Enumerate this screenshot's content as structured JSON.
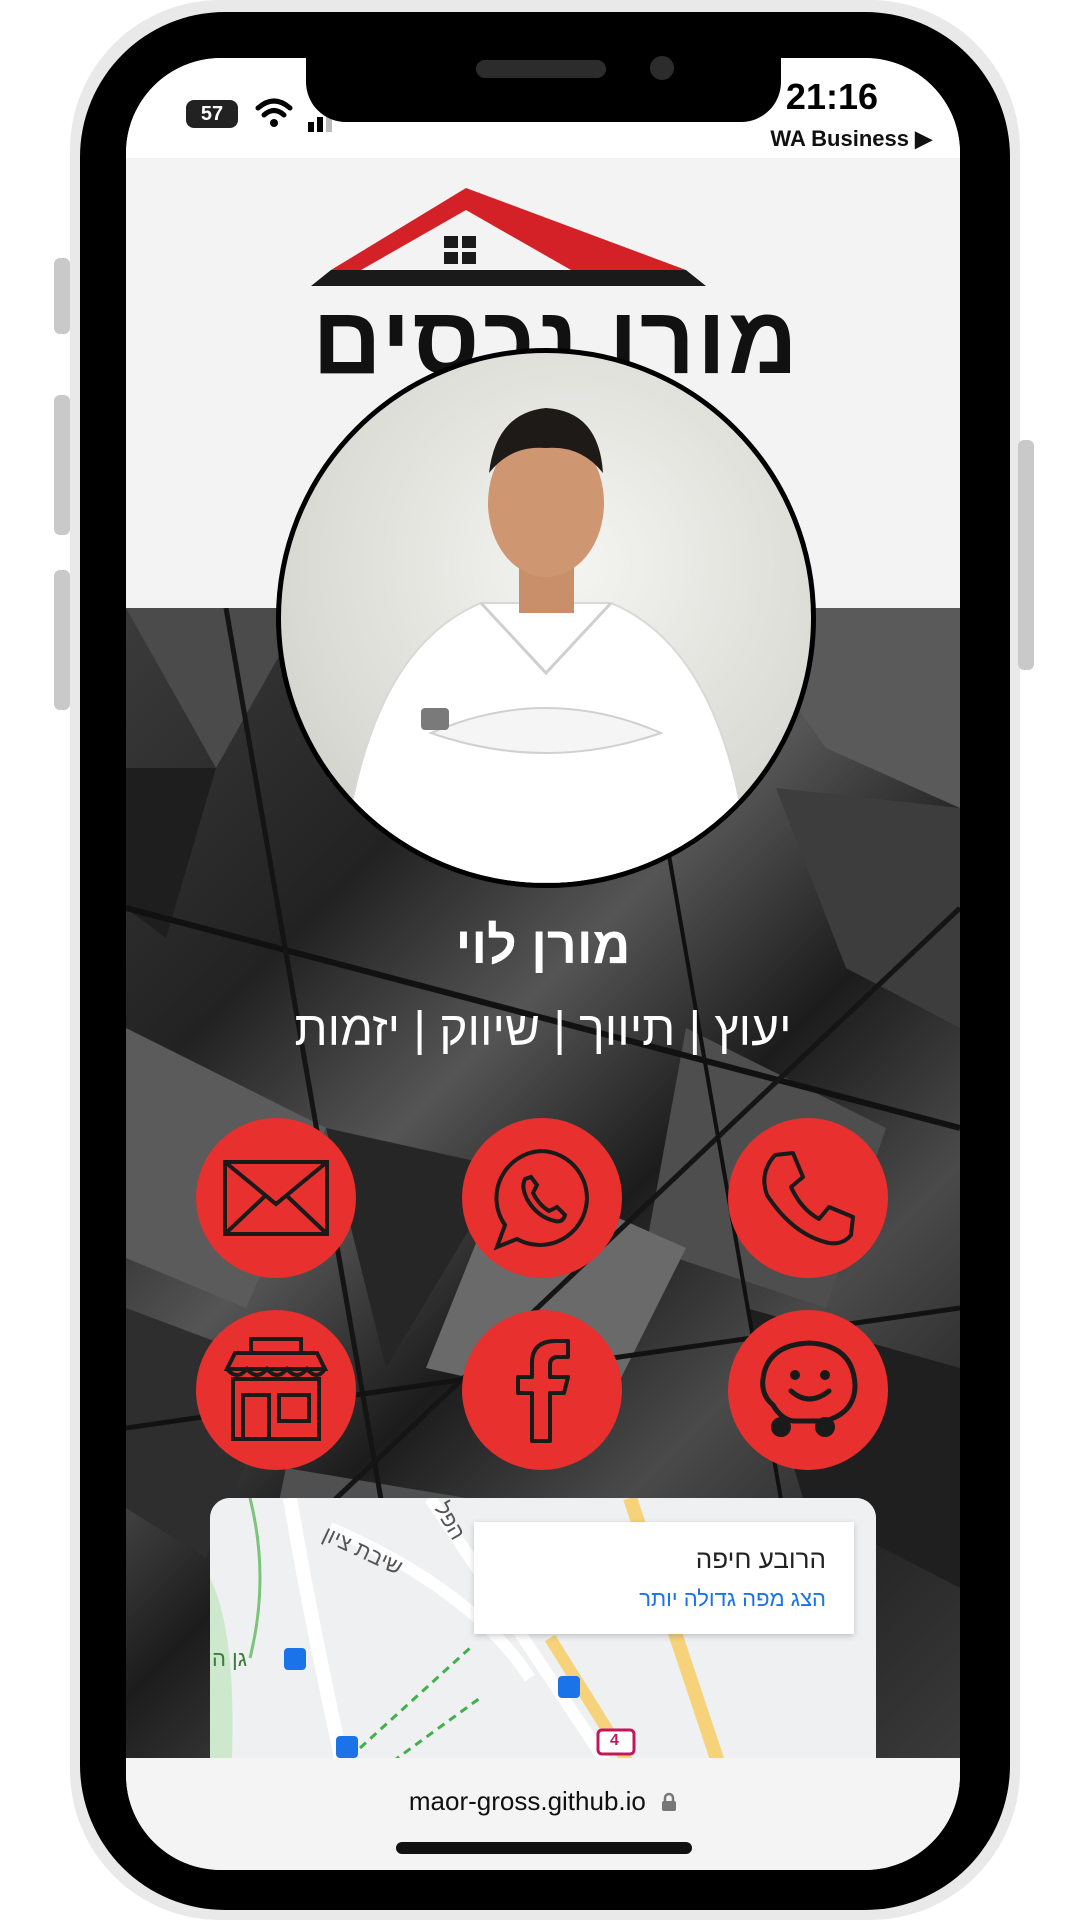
{
  "status_bar": {
    "time": "21:16",
    "back_app_label": "WA Business ▶",
    "battery_level": "57"
  },
  "logo": {
    "brand_text": "מורן נכסים"
  },
  "profile": {
    "name": "מורן לוי",
    "tagline": "יעוץ | תיווך | שיווק | יזמות"
  },
  "actions": [
    {
      "id": "phone",
      "icon": "phone-icon"
    },
    {
      "id": "whatsapp",
      "icon": "whatsapp-icon"
    },
    {
      "id": "email",
      "icon": "email-icon"
    },
    {
      "id": "waze",
      "icon": "waze-icon"
    },
    {
      "id": "facebook",
      "icon": "facebook-icon"
    },
    {
      "id": "store",
      "icon": "store-icon"
    }
  ],
  "map": {
    "place_name": "הרובע חיפה",
    "larger_map_link": "הצג מפה גדולה יותר",
    "street_labels": [
      "שיבת ציון",
      "גן ה",
      "הפל",
      "4"
    ]
  },
  "browser": {
    "url": "maor-gross.github.io"
  },
  "colors": {
    "accent_red": "#e8302e",
    "logo_red": "#d42027",
    "dark_bg": "#2a2a2a"
  }
}
